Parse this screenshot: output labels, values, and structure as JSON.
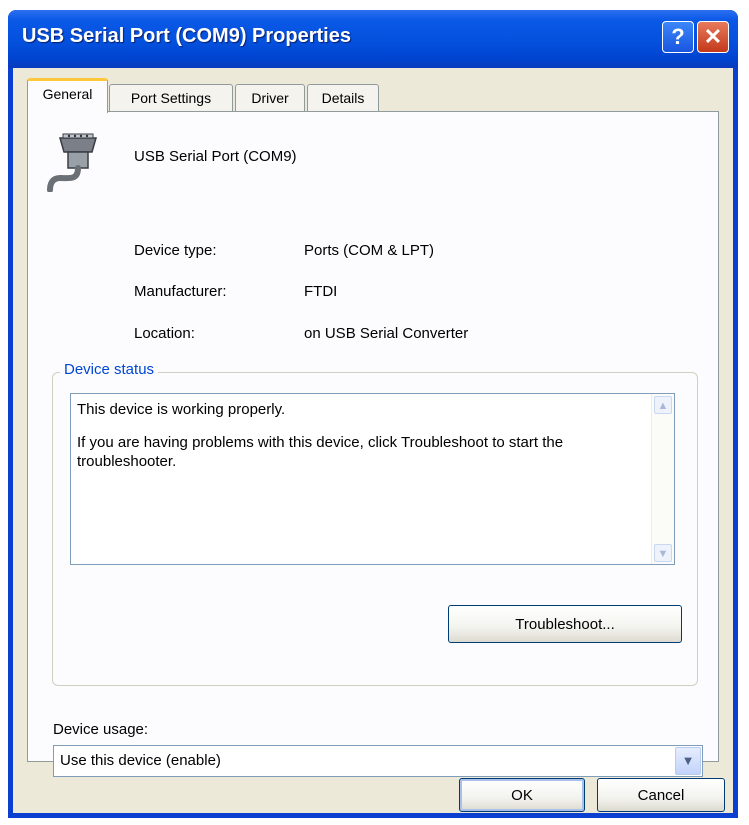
{
  "window": {
    "title": "USB Serial Port (COM9) Properties"
  },
  "titlebar_buttons": {
    "help": "?",
    "close": "✕"
  },
  "tabs": [
    {
      "label": "General",
      "active": true
    },
    {
      "label": "Port Settings",
      "active": false
    },
    {
      "label": "Driver",
      "active": false
    },
    {
      "label": "Details",
      "active": false
    }
  ],
  "general": {
    "device_name": "USB Serial Port (COM9)",
    "properties": {
      "device_type_label": "Device type:",
      "device_type_value": "Ports (COM & LPT)",
      "manufacturer_label": "Manufacturer:",
      "manufacturer_value": "FTDI",
      "location_label": "Location:",
      "location_value": "on USB Serial Converter"
    },
    "device_status": {
      "legend": "Device status",
      "line1": "This device is working properly.",
      "line2": "If you are having problems with this device, click Troubleshoot to start the troubleshooter.",
      "troubleshoot_label": "Troubleshoot..."
    },
    "device_usage": {
      "label": "Device usage:",
      "selected": "Use this device (enable)"
    }
  },
  "buttons": {
    "ok": "OK",
    "cancel": "Cancel"
  },
  "colors": {
    "titlebar": "#0451de",
    "dialog_face": "#ece9d8",
    "group_legend": "#0046d5",
    "active_tab_accent": "#ffc83c"
  },
  "icons": {
    "device": "serial-port-icon",
    "dropdown": "chevron-down-icon"
  }
}
